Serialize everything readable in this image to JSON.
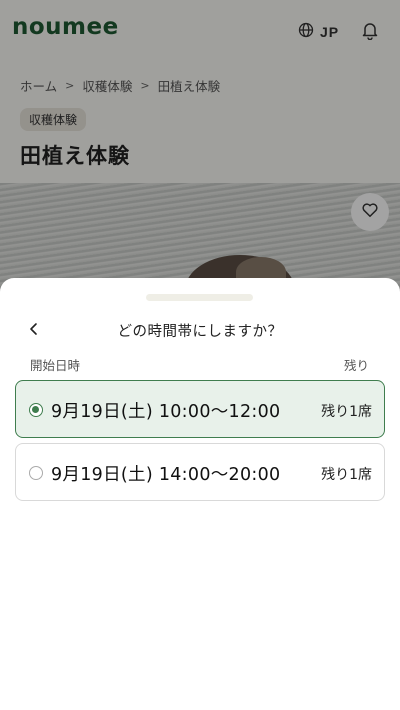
{
  "header": {
    "logo": "noumee",
    "language": "JP",
    "icons": [
      "globe-icon",
      "bell-icon"
    ]
  },
  "breadcrumb": [
    "ホーム",
    "収穫体験",
    "田植え体験"
  ],
  "category_tag": "収穫体験",
  "page_title": "田植え体験",
  "sheet": {
    "title": "どの時間帯にしますか？",
    "col_start": "開始日時",
    "col_remaining": "残り",
    "slots": [
      {
        "time": "9月19日(土) 10:00〜12:00",
        "remaining": "残り1席",
        "selected": true
      },
      {
        "time": "9月19日(土) 14:00〜20:00",
        "remaining": "残り1席",
        "selected": false
      }
    ]
  },
  "colors": {
    "brand": "#1f5a32",
    "accent": "#3f7d4e",
    "selected_bg": "#e8f1ea"
  }
}
